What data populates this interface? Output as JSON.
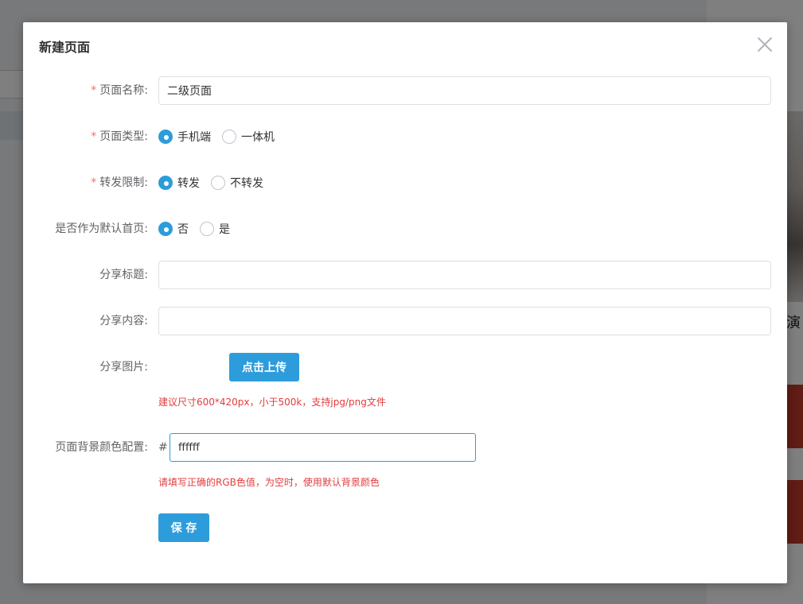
{
  "modal": {
    "title": "新建页面"
  },
  "form": {
    "required_mark": "*",
    "page_name": {
      "label": "页面名称:",
      "value": "二级页面"
    },
    "page_type": {
      "label": "页面类型:",
      "options": [
        {
          "label": "手机端",
          "checked": true
        },
        {
          "label": "一体机",
          "checked": false
        }
      ]
    },
    "forward_limit": {
      "label": "转发限制:",
      "options": [
        {
          "label": "转发",
          "checked": true
        },
        {
          "label": "不转发",
          "checked": false
        }
      ]
    },
    "default_home": {
      "label": "是否作为默认首页:",
      "options": [
        {
          "label": "否",
          "checked": true
        },
        {
          "label": "是",
          "checked": false
        }
      ]
    },
    "share_title": {
      "label": "分享标题:",
      "value": ""
    },
    "share_content": {
      "label": "分享内容:",
      "value": ""
    },
    "share_image": {
      "label": "分享图片:",
      "upload_label": "点击上传",
      "hint": "建议尺寸600*420px，小于500k，支持jpg/png文件"
    },
    "bg_color": {
      "label": "页面背景颜色配置:",
      "prefix": "#",
      "value": "ffffff",
      "hint": "请填写正确的RGB色值，为空时，使用默认背景颜色"
    },
    "save_label": "保 存"
  },
  "background": {
    "partial_text": "演"
  },
  "colors": {
    "primary": "#2d9cdb",
    "required": "#f56c6c",
    "hint": "#e23c3c"
  }
}
